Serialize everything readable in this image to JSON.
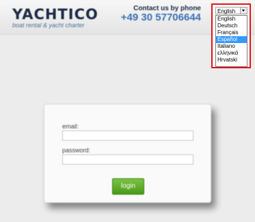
{
  "header": {
    "logo": "YACHTICO",
    "tagline": "boat rental & yacht charter",
    "contact_label": "Contact us by phone",
    "phone": "+49 30 57706644"
  },
  "language": {
    "selected": "English",
    "options": [
      "English",
      "Deutsch",
      "Français",
      "Español",
      "Italiano",
      "ελληνικά",
      "Hrvatski"
    ],
    "highlighted": "Español"
  },
  "login": {
    "email_label": "email:",
    "email_value": "",
    "password_label": "password:",
    "password_value": "",
    "button_label": "login"
  },
  "colors": {
    "highlight": "#e0141e",
    "option_highlight": "#3399ff",
    "login_button": "#5fae2c"
  }
}
